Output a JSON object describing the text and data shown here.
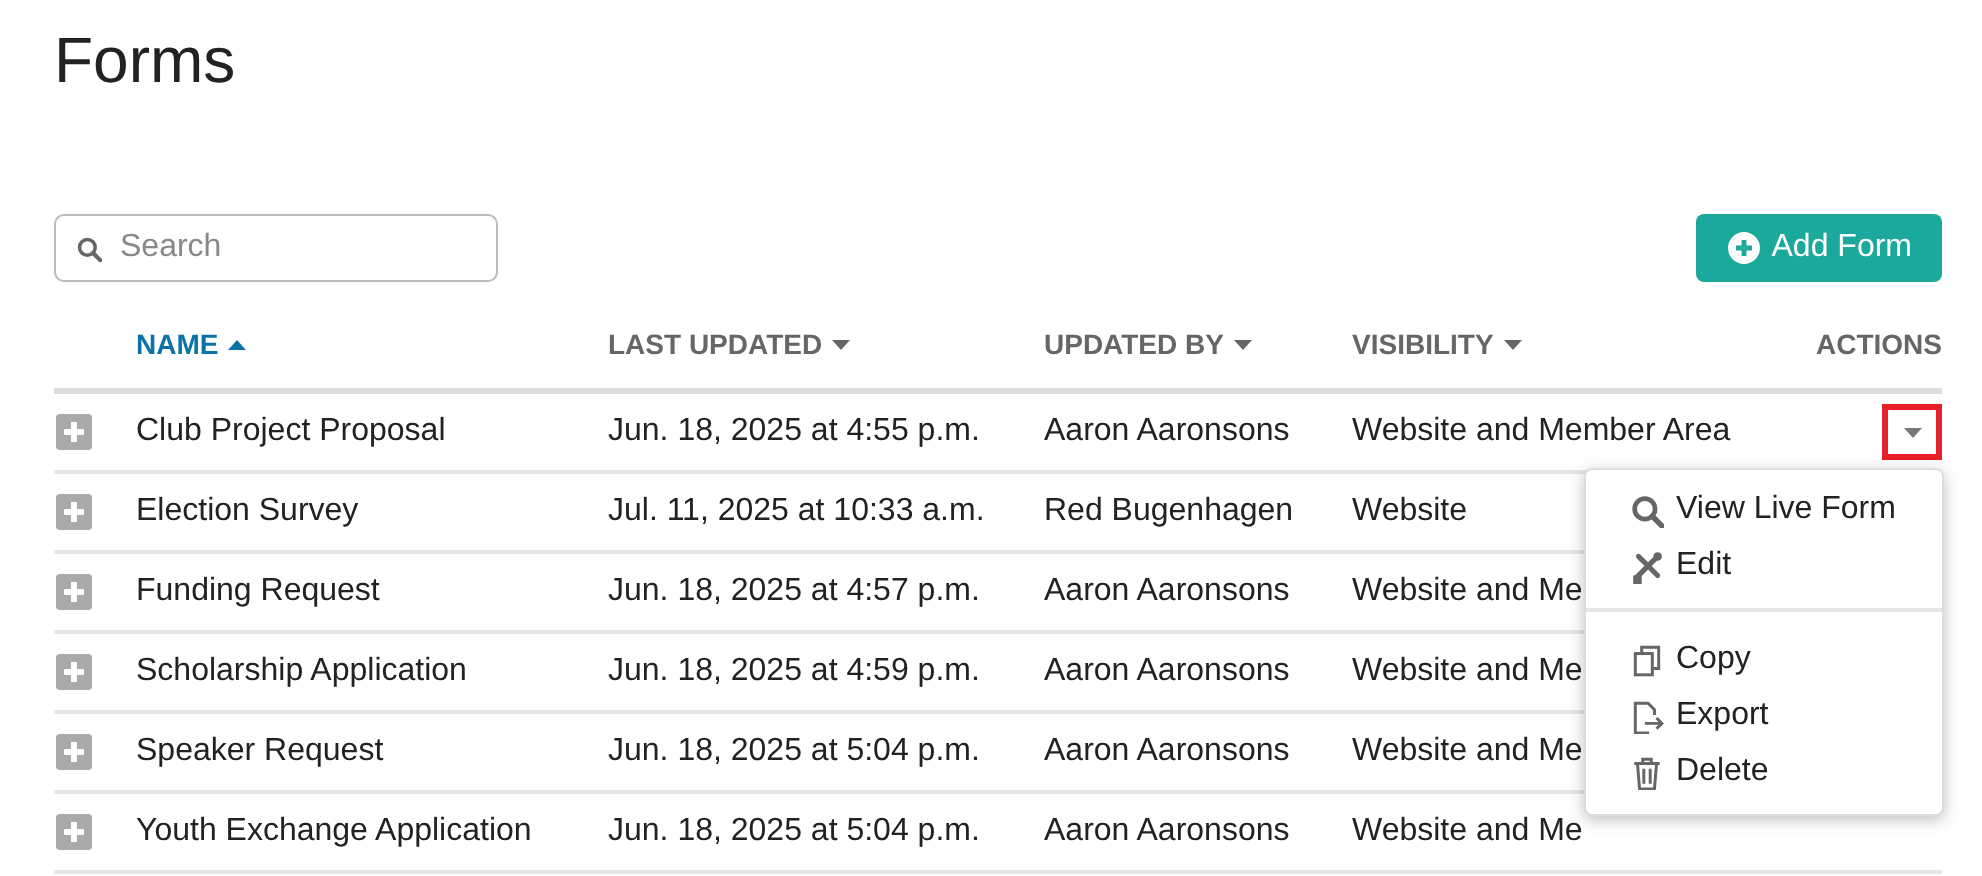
{
  "page": {
    "title": "Forms"
  },
  "search": {
    "placeholder": "Search"
  },
  "add_button": {
    "label": "Add Form"
  },
  "table": {
    "columns": [
      {
        "label": "NAME",
        "selected": true,
        "ascending": true
      },
      {
        "label": "LAST UPDATED",
        "selected": false,
        "ascending": false
      },
      {
        "label": "UPDATED BY",
        "selected": false,
        "ascending": false
      },
      {
        "label": "VISIBILITY",
        "selected": false,
        "ascending": false
      },
      {
        "label": "ACTIONS",
        "selected": false
      }
    ],
    "rows": [
      {
        "name": "Club Project Proposal",
        "last_updated": "Jun. 18, 2025 at 4:55 p.m.",
        "updated_by": "Aaron Aaronsons",
        "visibility": "Website and Member Area",
        "expanded": false,
        "menu_open": true
      },
      {
        "name": "Election Survey",
        "last_updated": "Jul. 11, 2025 at 10:33 a.m.",
        "updated_by": "Red Bugenhagen",
        "visibility": "Website",
        "expanded": false,
        "menu_open": false
      },
      {
        "name": "Funding Request",
        "last_updated": "Jun. 18, 2025 at 4:57 p.m.",
        "updated_by": "Aaron Aaronsons",
        "visibility": "Website and Me",
        "expanded": false,
        "menu_open": false
      },
      {
        "name": "Scholarship Application",
        "last_updated": "Jun. 18, 2025 at 4:59 p.m.",
        "updated_by": "Aaron Aaronsons",
        "visibility": "Website and Me",
        "expanded": false,
        "menu_open": false
      },
      {
        "name": "Speaker Request",
        "last_updated": "Jun. 18, 2025 at 5:04 p.m.",
        "updated_by": "Aaron Aaronsons",
        "visibility": "Website and Me",
        "expanded": false,
        "menu_open": false
      },
      {
        "name": "Youth Exchange Application",
        "last_updated": "Jun. 18, 2025 at 5:04 p.m.",
        "updated_by": "Aaron Aaronsons",
        "visibility": "Website and Me",
        "expanded": false,
        "menu_open": false
      }
    ]
  },
  "actions_menu": {
    "items": [
      {
        "label": "View Live Form",
        "kind": "search"
      },
      {
        "label": "Edit",
        "kind": "tools"
      },
      {
        "kind": "divider"
      },
      {
        "label": "Copy",
        "kind": "copy"
      },
      {
        "label": "Export",
        "kind": "export"
      },
      {
        "label": "Delete",
        "kind": "trash"
      }
    ]
  }
}
